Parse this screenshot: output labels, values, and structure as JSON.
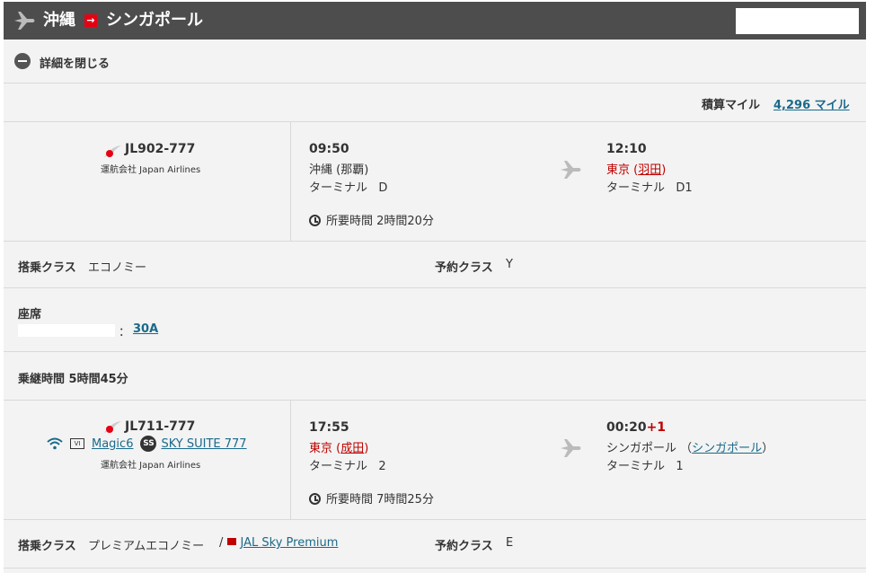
{
  "header": {
    "origin": "沖縄",
    "arrow": "→",
    "destination": "シンガポール"
  },
  "toggle": {
    "label": "詳細を閉じる"
  },
  "miles": {
    "label": "積算マイル",
    "value": "4,296 マイル"
  },
  "segments": [
    {
      "flight_no": "JL902-777",
      "operator": "運航会社 Japan Airlines",
      "dep_time": "09:50",
      "dep_place": "沖縄 (那覇)",
      "dep_terminal_label": "ターミナル",
      "dep_terminal": "D",
      "duration": "所要時間 2時間20分",
      "arr_time": "12:10",
      "arr_place_city": "東京",
      "arr_place_airport": "羽田",
      "arr_terminal_label": "ターミナル",
      "arr_terminal": "D1"
    },
    {
      "flight_no": "JL711-777",
      "wifi": "wifi-icon",
      "vi_label": "VI",
      "magic": "Magic6",
      "ss_badge": "SS",
      "seat": "SKY SUITE 777",
      "operator": "運航会社 Japan Airlines",
      "dep_time": "17:55",
      "dep_place_city": "東京",
      "dep_place_airport": "成田",
      "dep_terminal_label": "ターミナル",
      "dep_terminal": "2",
      "duration": "所要時間 7時間25分",
      "arr_time": "00:20",
      "arr_dayoffset": "+1",
      "arr_place_city": "シンガポール",
      "arr_place_airport": "シンガポール",
      "arr_terminal_label": "ターミナル",
      "arr_terminal": "1"
    }
  ],
  "class1": {
    "label": "搭乗クラス",
    "value": "エコノミー",
    "booking_label": "予約クラス",
    "booking_value": "Y"
  },
  "seat": {
    "label": "座席",
    "sep": "：",
    "value": "30A"
  },
  "layover": {
    "text": "乗継時間 5時間45分"
  },
  "class2": {
    "label": "搭乗クラス",
    "value": "プレミアムエコノミー",
    "slash": "/",
    "program": "JAL Sky Premium",
    "booking_label": "予約クラス",
    "booking_value": "E"
  },
  "colors": {
    "header_bg": "#4d4d4d",
    "accent_red": "#e60012",
    "link": "#1a6a8a"
  }
}
